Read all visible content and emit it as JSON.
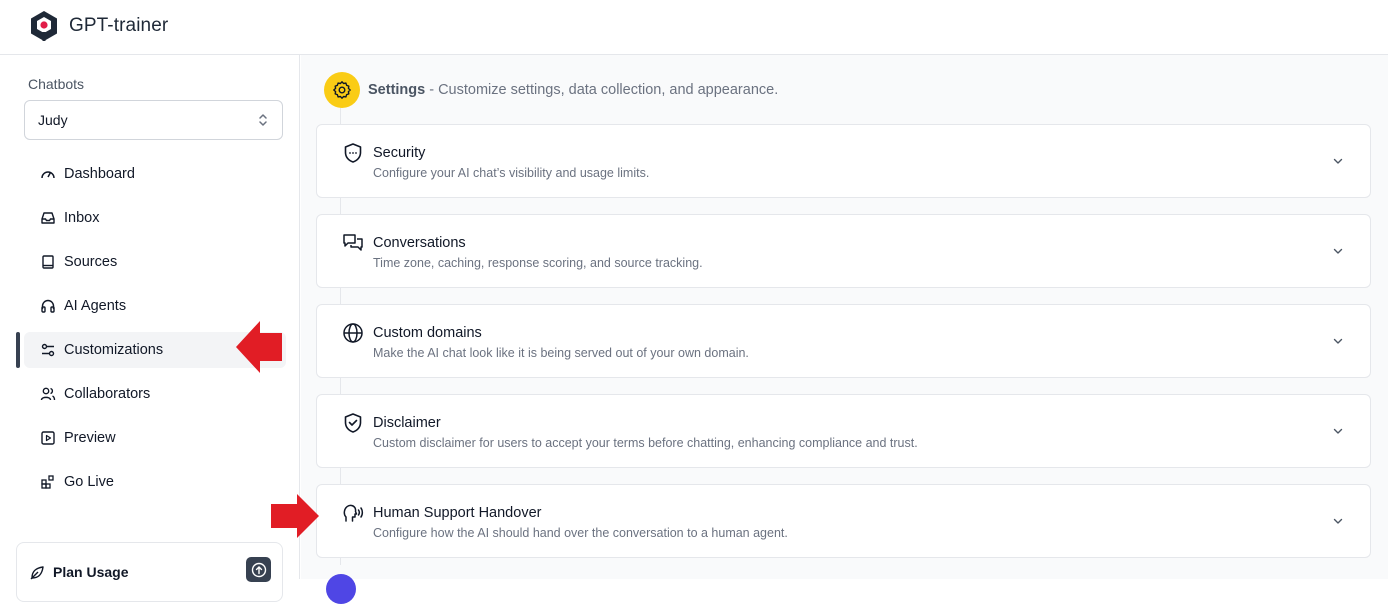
{
  "app": {
    "name": "GPT-trainer"
  },
  "sidebar": {
    "heading": "Chatbots",
    "selected_bot": "Judy",
    "items": [
      {
        "label": "Dashboard",
        "icon": "gauge-icon"
      },
      {
        "label": "Inbox",
        "icon": "inbox-icon"
      },
      {
        "label": "Sources",
        "icon": "book-icon"
      },
      {
        "label": "AI Agents",
        "icon": "headphones-icon"
      },
      {
        "label": "Customizations",
        "icon": "sliders-icon",
        "active": true
      },
      {
        "label": "Collaborators",
        "icon": "users-icon"
      },
      {
        "label": "Preview",
        "icon": "play-square-icon"
      },
      {
        "label": "Go Live",
        "icon": "blocks-icon"
      }
    ],
    "plan_usage_label": "Plan Usage"
  },
  "main": {
    "section_title": "Settings",
    "section_subtitle": " - Customize settings, data collection, and appearance.",
    "cards": [
      {
        "title": "Security",
        "description": "Configure your AI chat’s visibility and usage limits.",
        "icon": "shield-icon"
      },
      {
        "title": "Conversations",
        "description": "Time zone, caching, response scoring, and source tracking.",
        "icon": "chat-bubbles-icon"
      },
      {
        "title": "Custom domains",
        "description": "Make the AI chat look like it is being served out of your own domain.",
        "icon": "globe-icon"
      },
      {
        "title": "Disclaimer",
        "description": "Custom disclaimer for users to accept your terms before chatting, enhancing compliance and trust.",
        "icon": "shield-check-icon"
      },
      {
        "title": "Human Support Handover",
        "description": "Configure how the AI should hand over the conversation to a human agent.",
        "icon": "speaking-head-icon"
      }
    ]
  },
  "colors": {
    "accent_yellow": "#facc15",
    "annotation_red": "#e11d25",
    "active_bar": "#374151"
  }
}
